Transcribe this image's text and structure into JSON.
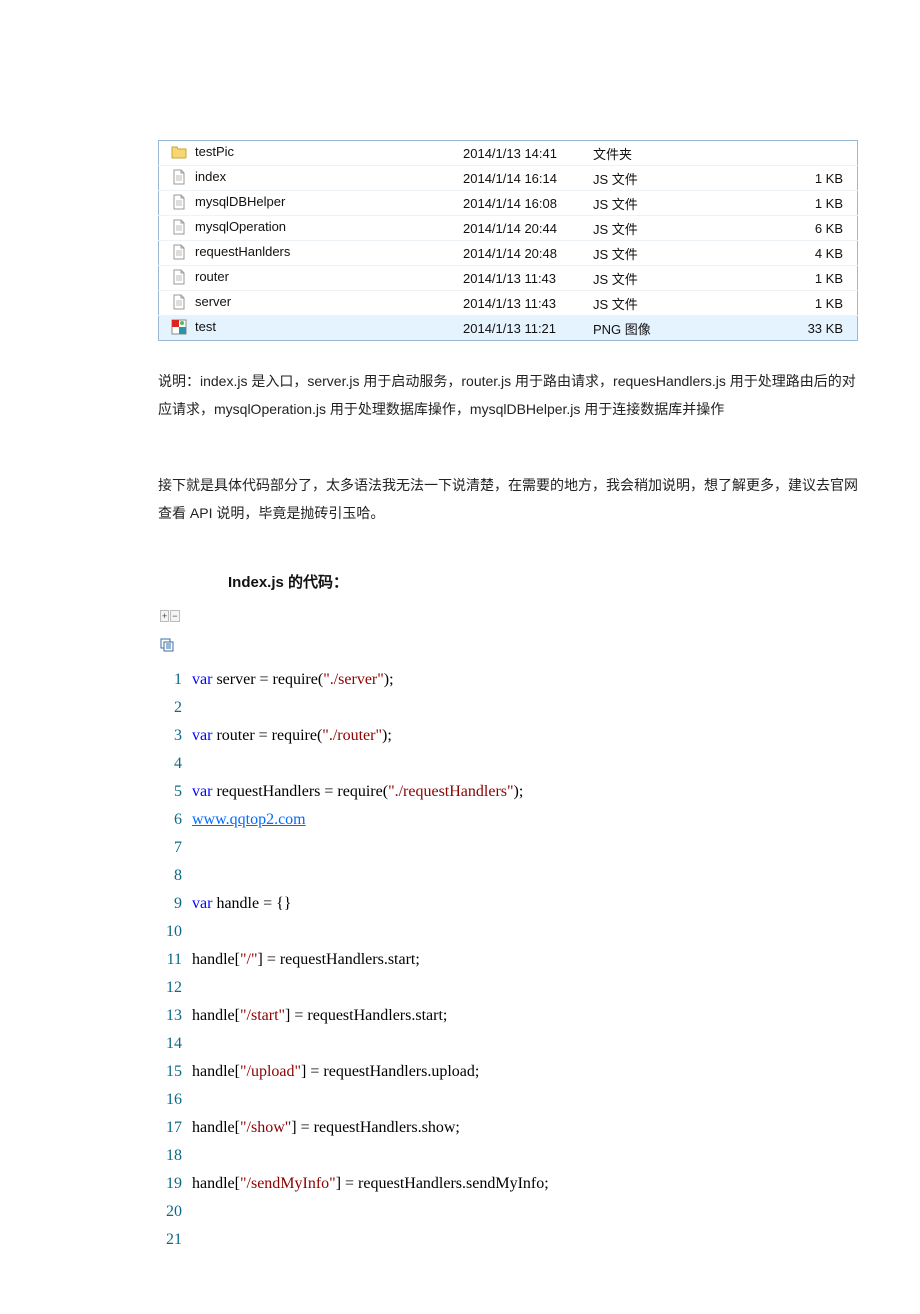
{
  "files": [
    {
      "icon": "folder",
      "name": "testPic",
      "date": "2014/1/13 14:41",
      "type": "文件夹",
      "size": ""
    },
    {
      "icon": "file",
      "name": "index",
      "date": "2014/1/14 16:14",
      "type": "JS 文件",
      "size": "1 KB"
    },
    {
      "icon": "file",
      "name": "mysqlDBHelper",
      "date": "2014/1/14 16:08",
      "type": "JS 文件",
      "size": "1 KB"
    },
    {
      "icon": "file",
      "name": "mysqlOperation",
      "date": "2014/1/14 20:44",
      "type": "JS 文件",
      "size": "6 KB"
    },
    {
      "icon": "file",
      "name": "requestHanlders",
      "date": "2014/1/14 20:48",
      "type": "JS 文件",
      "size": "4 KB"
    },
    {
      "icon": "file",
      "name": "router",
      "date": "2014/1/13 11:43",
      "type": "JS 文件",
      "size": "1 KB"
    },
    {
      "icon": "file",
      "name": "server",
      "date": "2014/1/13 11:43",
      "type": "JS 文件",
      "size": "1 KB"
    },
    {
      "icon": "png",
      "name": "test",
      "date": "2014/1/13 11:21",
      "type": "PNG 图像",
      "size": "33 KB"
    }
  ],
  "desc1": "说明：index.js 是入口，server.js 用于启动服务，router.js 用于路由请求，requesHandlers.js 用于处理路由后的对应请求，mysqlOperation.js 用于处理数据库操作，mysqlDBHelper.js 用于连接数据库并操作",
  "desc2": "接下就是具体代码部分了，太多语法我无法一下说清楚，在需要的地方，我会稍加说明，想了解更多，建议去官网查看 API 说明，毕竟是抛砖引玉哈。",
  "section_title": "Index.js 的代码：",
  "toolbar": {
    "expand": "+",
    "collapse": "−"
  },
  "link_text": "www.qqtop2.com",
  "code": [
    {
      "n": 1,
      "segs": [
        {
          "k": "kw",
          "t": "var"
        },
        {
          "t": " server = require("
        },
        {
          "k": "str",
          "t": "\"./server\""
        },
        {
          "t": ");"
        }
      ]
    },
    {
      "n": 2,
      "segs": []
    },
    {
      "n": 3,
      "segs": [
        {
          "k": "kw",
          "t": "var"
        },
        {
          "t": " router = require("
        },
        {
          "k": "str",
          "t": "\"./router\""
        },
        {
          "t": ");"
        }
      ]
    },
    {
      "n": 4,
      "segs": []
    },
    {
      "n": 5,
      "segs": [
        {
          "k": "kw",
          "t": "var"
        },
        {
          "t": " requestHandlers = require("
        },
        {
          "k": "str",
          "t": "\"./requestHandlers\""
        },
        {
          "t": ");"
        }
      ]
    },
    {
      "n": 6,
      "segs": [
        {
          "k": "link",
          "t": "www.qqtop2.com"
        }
      ]
    },
    {
      "n": 7,
      "segs": []
    },
    {
      "n": 8,
      "segs": []
    },
    {
      "n": 9,
      "segs": [
        {
          "k": "kw",
          "t": "var"
        },
        {
          "t": " handle = {}"
        }
      ]
    },
    {
      "n": 10,
      "segs": []
    },
    {
      "n": 11,
      "segs": [
        {
          "t": "handle["
        },
        {
          "k": "str",
          "t": "\"/\""
        },
        {
          "t": "] = requestHandlers.start;"
        }
      ]
    },
    {
      "n": 12,
      "segs": []
    },
    {
      "n": 13,
      "segs": [
        {
          "t": "handle["
        },
        {
          "k": "str",
          "t": "\"/start\""
        },
        {
          "t": "] = requestHandlers.start;"
        }
      ]
    },
    {
      "n": 14,
      "segs": []
    },
    {
      "n": 15,
      "segs": [
        {
          "t": "handle["
        },
        {
          "k": "str",
          "t": "\"/upload\""
        },
        {
          "t": "] = requestHandlers.upload;"
        }
      ]
    },
    {
      "n": 16,
      "segs": []
    },
    {
      "n": 17,
      "segs": [
        {
          "t": "handle["
        },
        {
          "k": "str",
          "t": "\"/show\""
        },
        {
          "t": "] = requestHandlers.show;"
        }
      ]
    },
    {
      "n": 18,
      "segs": []
    },
    {
      "n": 19,
      "segs": [
        {
          "t": "handle["
        },
        {
          "k": "str",
          "t": "\"/sendMyInfo\""
        },
        {
          "t": "] = requestHandlers.sendMyInfo;"
        }
      ]
    },
    {
      "n": 20,
      "segs": []
    },
    {
      "n": 21,
      "segs": []
    }
  ]
}
